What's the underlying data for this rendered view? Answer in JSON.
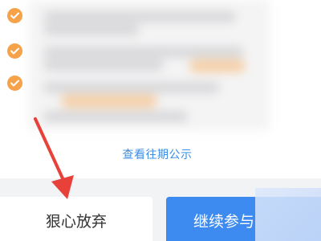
{
  "benefits": {
    "items": [
      {
        "icon": "check-circle-icon"
      },
      {
        "icon": "check-circle-icon"
      },
      {
        "icon": "check-circle-icon"
      }
    ]
  },
  "links": {
    "view_past_notices": "查看往期公示"
  },
  "actions": {
    "give_up_label": "狠心放弃",
    "continue_label": "继续参与"
  },
  "colors": {
    "accent_blue": "#3d8bf0",
    "link_blue": "#3a8ee6",
    "check_orange": "#f5a24b",
    "annotation_red": "#e8413a"
  }
}
